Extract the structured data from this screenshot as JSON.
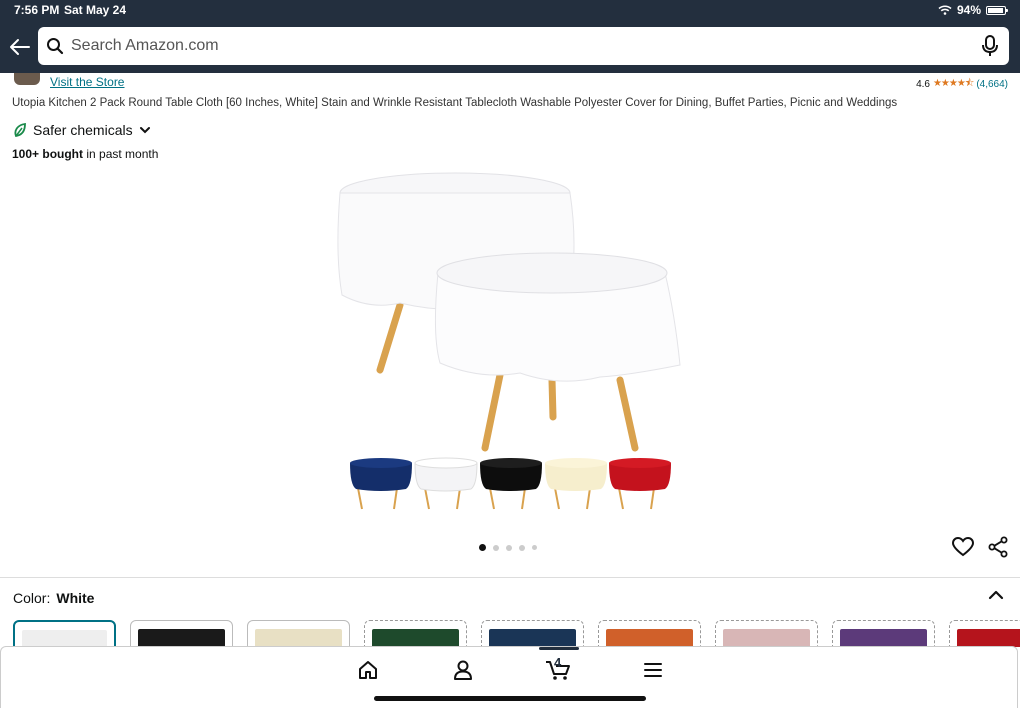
{
  "status": {
    "time": "7:56 PM",
    "date": "Sat May 24",
    "battery": "94%",
    "battery_level": 0.94
  },
  "search": {
    "placeholder": "Search Amazon.com"
  },
  "product": {
    "visit_store": "Visit the Store",
    "rating": "4.6",
    "rating_count": "(4,664)",
    "title": "Utopia Kitchen 2 Pack Round Table Cloth [60 Inches, White] Stain and Wrinkle Resistant Tablecloth Washable Polyester Cover for Dining, Buffet Parties, Picnic and Weddings",
    "badge": "Safer chemicals",
    "bought_bold": "100+ bought",
    "bought_rest": " in past month"
  },
  "gallery": {
    "image_count": 5,
    "active_index": 0
  },
  "color": {
    "label": "Color:",
    "selected": "White",
    "swatches": [
      {
        "name": "White",
        "color": "#eeeeee",
        "selected": true,
        "available": true
      },
      {
        "name": "Black",
        "color": "#1a1a1a",
        "selected": false,
        "available": true
      },
      {
        "name": "Ivory",
        "color": "#e8e0c4",
        "selected": false,
        "available": true
      },
      {
        "name": "Green",
        "color": "#1e4a2c",
        "selected": false,
        "available": false
      },
      {
        "name": "Navy",
        "color": "#1a3556",
        "selected": false,
        "available": false
      },
      {
        "name": "Orange",
        "color": "#d0602a",
        "selected": false,
        "available": false
      },
      {
        "name": "Pink",
        "color": "#d8b6b6",
        "selected": false,
        "available": false
      },
      {
        "name": "Purple",
        "color": "#5c3a7a",
        "selected": false,
        "available": false
      },
      {
        "name": "Red",
        "color": "#b5141c",
        "selected": false,
        "available": false
      }
    ]
  },
  "nav": {
    "cart_count": "4"
  },
  "colors": {
    "header_bg": "#232f3e",
    "link": "#007185",
    "star": "#de7921"
  }
}
